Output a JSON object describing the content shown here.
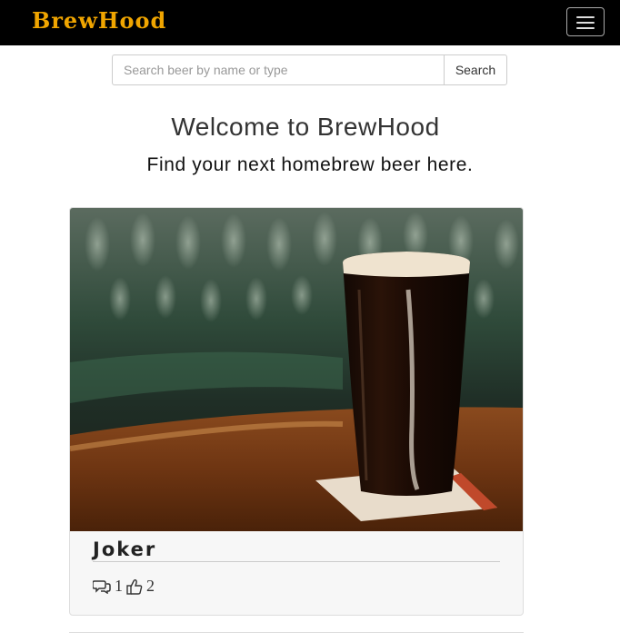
{
  "navbar": {
    "brand": "BrewHood",
    "menu_icon": "hamburger-menu-icon"
  },
  "search": {
    "placeholder": "Search beer by name or type",
    "value": "",
    "button_label": "Search"
  },
  "hero": {
    "title": "Welcome to BrewHood",
    "subtitle": "Find your next homebrew beer here."
  },
  "cards": [
    {
      "title": "Joker",
      "comments": "1",
      "likes": "2",
      "comment_icon": "comments-icon",
      "like_icon": "thumbs-up-icon"
    }
  ],
  "colors": {
    "navbar_bg": "#000000",
    "brand": "#f0a500"
  }
}
